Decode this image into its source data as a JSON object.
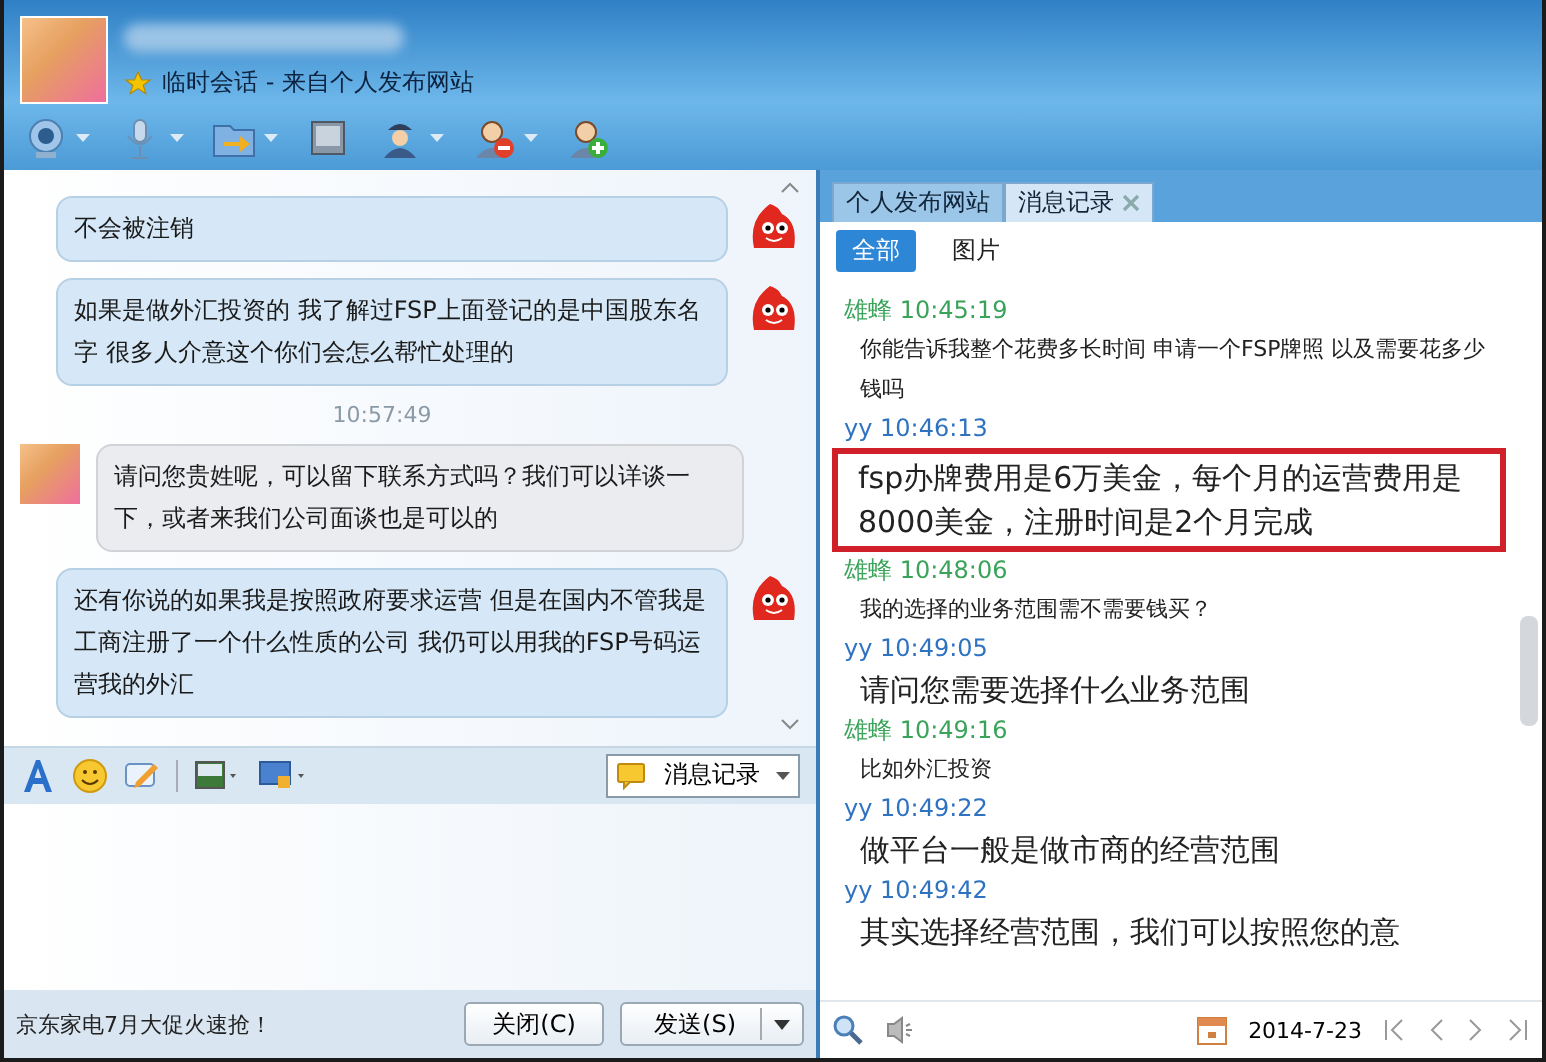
{
  "header": {
    "session_label": "临时会话 - 来自个人发布网站"
  },
  "chat": {
    "messages": [
      {
        "kind": "outgoing",
        "text": "不会被注销"
      },
      {
        "kind": "outgoing",
        "text": "如果是做外汇投资的  我了解过FSP上面登记的是中国股东名字 很多人介意这个你们会怎么帮忙处理的"
      },
      {
        "kind": "time",
        "text": "10:57:49"
      },
      {
        "kind": "incoming",
        "text": "请问您贵姓呢，可以留下联系方式吗？我们可以详谈一下，或者来我们公司面谈也是可以的"
      },
      {
        "kind": "outgoing",
        "text": "还有你说的如果我是按照政府要求运营 但是在国内不管我是工商注册了一个什么性质的公司 我仍可以用我的FSP号码运营我的外汇"
      }
    ]
  },
  "history_button": "消息记录",
  "ad_text": "京东家电7月大促火速抢！",
  "buttons": {
    "close": "关闭(C)",
    "send": "发送(S)"
  },
  "side_tabs": [
    {
      "label": "个人发布网站",
      "selected": false,
      "closable": false
    },
    {
      "label": "消息记录",
      "selected": true,
      "closable": true
    }
  ],
  "filters": [
    {
      "label": "全部",
      "selected": true
    },
    {
      "label": "图片",
      "selected": false
    }
  ],
  "history": [
    {
      "kind": "peer",
      "sender": "雄蜂",
      "time": "10:45:19",
      "text": "你能告诉我整个花费多长时间 申请一个FSP牌照  以及需要花多少钱吗",
      "highlighted": false
    },
    {
      "kind": "self",
      "sender": "yy",
      "time": "10:46:13",
      "text": "fsp办牌费用是6万美金，每个月的运营费用是8000美金，注册时间是2个月完成",
      "highlighted": true
    },
    {
      "kind": "peer",
      "sender": "雄蜂",
      "time": "10:48:06",
      "text": "我的选择的业务范围需不需要钱买？",
      "highlighted": false
    },
    {
      "kind": "self",
      "sender": "yy",
      "time": "10:49:05",
      "text": "请问您需要选择什么业务范围",
      "highlighted": false
    },
    {
      "kind": "peer",
      "sender": "雄蜂",
      "time": "10:49:16",
      "text": "比如外汇投资",
      "highlighted": false
    },
    {
      "kind": "self",
      "sender": "yy",
      "time": "10:49:22",
      "text": "做平台一般是做市商的经营范围",
      "highlighted": false
    },
    {
      "kind": "self",
      "sender": "yy",
      "time": "10:49:42",
      "text": "其实选择经营范围，我们可以按照您的意",
      "highlighted": false
    }
  ],
  "date": "2014-7-23"
}
